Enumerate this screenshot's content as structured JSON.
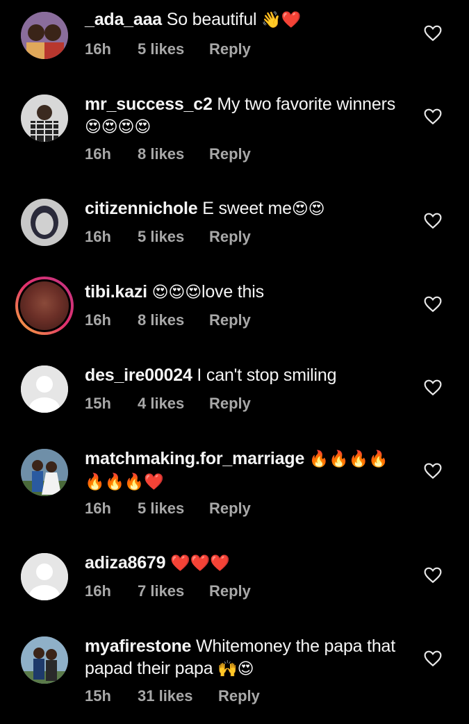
{
  "comments": [
    {
      "username": "_ada_aaa",
      "text": " So beautiful ",
      "emoji": "👋❤️",
      "time": "16h",
      "likes": "5 likes",
      "reply": "Reply"
    },
    {
      "username": "mr_success_c2",
      "text": " My two favorite winners ",
      "emoji": "😍😍😍😍",
      "time": "16h",
      "likes": "8 likes",
      "reply": "Reply"
    },
    {
      "username": "citizennichole",
      "text": " E sweet me",
      "emoji": "😍😍",
      "time": "16h",
      "likes": "5 likes",
      "reply": "Reply"
    },
    {
      "username": "tibi.kazi",
      "text": " ",
      "emoji": "😍😍😍",
      "text2": "love this",
      "time": "16h",
      "likes": "8 likes",
      "reply": "Reply"
    },
    {
      "username": "des_ire00024",
      "text": " I can't stop smiling",
      "emoji": "",
      "time": "15h",
      "likes": "4 likes",
      "reply": "Reply"
    },
    {
      "username": "matchmaking.for_marriage",
      "text": " ",
      "emoji": "🔥🔥🔥🔥 🔥🔥🔥❤️",
      "time": "16h",
      "likes": "5 likes",
      "reply": "Reply"
    },
    {
      "username": "adiza8679",
      "text": " ",
      "emoji": "❤️❤️❤️",
      "time": "16h",
      "likes": "7 likes",
      "reply": "Reply"
    },
    {
      "username": "myafirestone",
      "text": " Whitemoney the papa that papad their papa ",
      "emoji": "🙌😍",
      "time": "15h",
      "likes": "31 likes",
      "reply": "Reply"
    }
  ],
  "icons": {
    "like": "heart-outline-icon"
  },
  "colors": {
    "background": "#000000",
    "meta_text": "#a8a8a8",
    "text": "#f5f5f5"
  }
}
